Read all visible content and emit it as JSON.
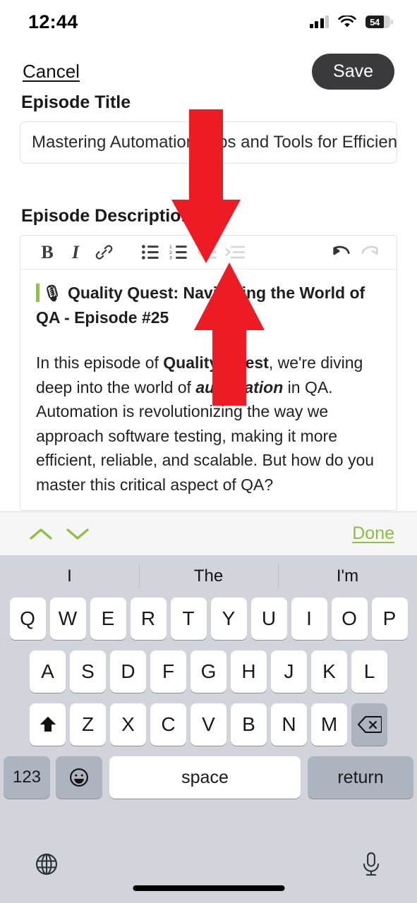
{
  "status_bar": {
    "time": "12:44",
    "battery_percent": "54",
    "signal_icon": "cellular-signal-icon",
    "wifi_icon": "wifi-icon",
    "battery_icon": "battery-icon"
  },
  "nav": {
    "cancel_label": "Cancel",
    "save_label": "Save"
  },
  "form": {
    "title_label": "Episode Title",
    "title_value": "Mastering Automation: Tips and Tools for Efficient C",
    "description_label": "Episode Description"
  },
  "toolbar": {
    "bold": "B",
    "italic": "I",
    "link": "link-icon",
    "bullet_list": "bullet-list-icon",
    "numbered_list": "numbered-list-icon",
    "outdent": "outdent-icon",
    "indent": "indent-icon",
    "undo": "undo-icon",
    "redo": "redo-icon"
  },
  "editor": {
    "emoji": "🎙",
    "heading": "Quality Quest: Navigating the World of QA - Episode #25",
    "paragraph_prefix": "In this episode of ",
    "paragraph_bold_1": "Quality Quest",
    "paragraph_mid": ", we're diving deep into the world of ",
    "paragraph_italic_1": "automation",
    "paragraph_suffix": " in QA. Automation is revolutionizing the way we approach software testing, making it more efficient, reliable, and scalable. But how do you master this critical aspect of QA?"
  },
  "accessory_bar": {
    "prev_label": "chevron-up-icon",
    "next_label": "chevron-down-icon",
    "done_label": "Done"
  },
  "keyboard": {
    "predictions": [
      "I",
      "The",
      "I'm"
    ],
    "row1": [
      "Q",
      "W",
      "E",
      "R",
      "T",
      "Y",
      "U",
      "I",
      "O",
      "P"
    ],
    "row2": [
      "A",
      "S",
      "D",
      "F",
      "G",
      "H",
      "J",
      "K",
      "L"
    ],
    "row3": [
      "Z",
      "X",
      "C",
      "V",
      "B",
      "N",
      "M"
    ],
    "shift_label": "shift-icon",
    "backspace_label": "backspace-icon",
    "numbers_label": "123",
    "emoji_label": "emoji-icon",
    "space_label": "space",
    "return_label": "return",
    "globe_label": "globe-icon",
    "mic_label": "microphone-icon"
  },
  "annotations": {
    "arrow_color": "#ED1C24",
    "arrow_down_target": "outdent-button",
    "arrow_up_target": "editor-text"
  },
  "colors": {
    "accent_green": "#8CBF3F",
    "save_button": "#3A3A3C",
    "keyboard_bg": "#D1D5DB",
    "special_key": "#ADB3BF"
  }
}
